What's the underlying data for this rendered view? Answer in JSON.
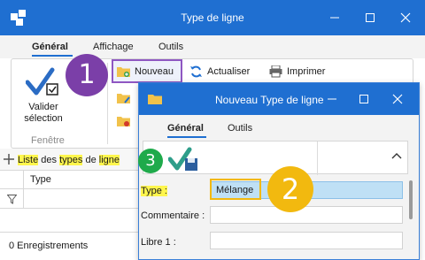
{
  "main_window": {
    "title": "Type de ligne",
    "tabs": [
      "Général",
      "Affichage",
      "Outils"
    ],
    "ribbon": {
      "valider_label": "Valider sélection",
      "group_label": "Fenêtre",
      "buttons": {
        "nouveau": "Nouveau",
        "actualiser": "Actualiser",
        "imprimer": "Imprimer"
      }
    },
    "list": {
      "title_parts": [
        "Liste",
        " des ",
        "types",
        " de ",
        "ligne"
      ],
      "column": "Type"
    },
    "status": "0 Enregistrements"
  },
  "dialog": {
    "title": "Nouveau Type de ligne",
    "tabs": [
      "Général",
      "Outils"
    ],
    "fields": [
      {
        "label": "Type :",
        "value": "Mélange"
      },
      {
        "label": "Commentaire :",
        "value": ""
      },
      {
        "label": "Libre 1 :",
        "value": ""
      }
    ]
  },
  "callouts": [
    {
      "number": "1",
      "color": "#7b3fa8"
    },
    {
      "number": "2",
      "color": "#f2b90f"
    },
    {
      "number": "3",
      "color": "#1faa4b"
    }
  ],
  "colors": {
    "titlebar": "#1f6fd1",
    "highlight_yellow": "#fff64d",
    "selected_field": "#bfe0f5"
  }
}
